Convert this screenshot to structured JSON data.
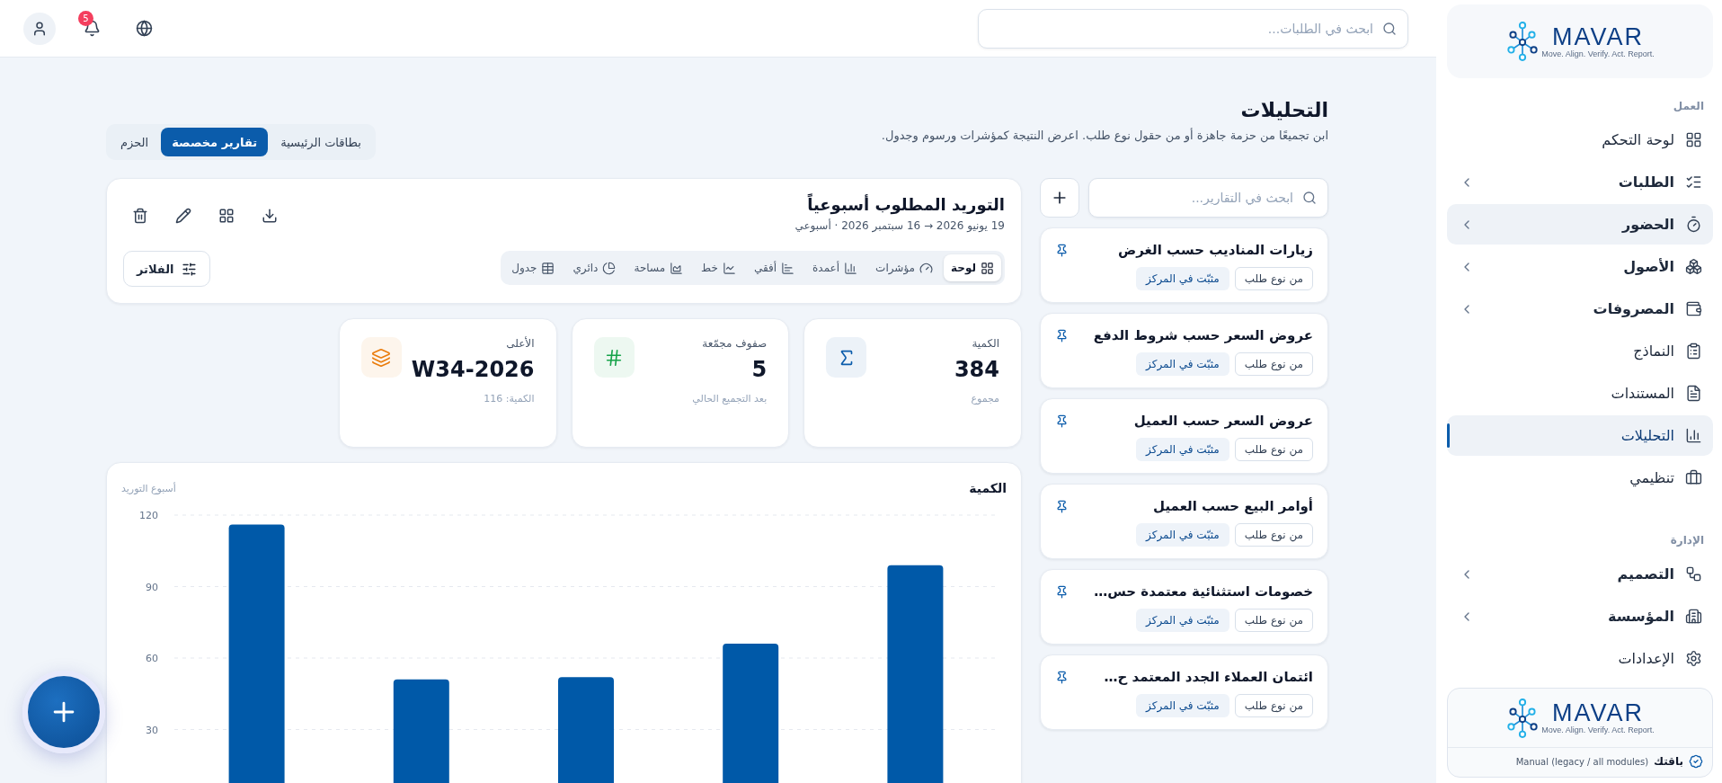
{
  "topbar": {
    "search": {
      "placeholder": "ابحث في الطلبات..."
    },
    "notifications": {
      "count": "5"
    }
  },
  "sidebar": {
    "logo": {
      "name": "MAVAR",
      "tagline": "Move. Align. Verify. Act. Report."
    },
    "sections": [
      {
        "title": "العمل",
        "items": [
          {
            "label": "لوحة التحكم",
            "has_submenu": false,
            "selected": false,
            "hovered": false
          },
          {
            "label": "الطلبات",
            "has_submenu": true,
            "selected": false,
            "hovered": false
          },
          {
            "label": "الحضور",
            "has_submenu": true,
            "selected": false,
            "hovered": true
          },
          {
            "label": "الأصول",
            "has_submenu": true,
            "selected": false,
            "hovered": false
          },
          {
            "label": "المصروفات",
            "has_submenu": true,
            "selected": false,
            "hovered": false
          },
          {
            "label": "النماذج",
            "has_submenu": false,
            "selected": false,
            "hovered": false
          },
          {
            "label": "المستندات",
            "has_submenu": false,
            "selected": false,
            "hovered": false
          },
          {
            "label": "التحليلات",
            "has_submenu": false,
            "selected": true,
            "hovered": false
          },
          {
            "label": "تنظيمي",
            "has_submenu": false,
            "selected": false,
            "hovered": false
          }
        ]
      },
      {
        "title": "الإدارة",
        "items": [
          {
            "label": "التصميم",
            "has_submenu": true,
            "selected": false,
            "hovered": false
          },
          {
            "label": "المؤسسة",
            "has_submenu": true,
            "selected": false,
            "hovered": false
          },
          {
            "label": "الإعدادات",
            "has_submenu": false,
            "selected": false,
            "hovered": false
          }
        ]
      }
    ],
    "plan": {
      "logo": {
        "name": "MAVAR",
        "tagline": "Move. Align. Verify. Act. Report."
      },
      "label": "باقتك",
      "value": "Manual (legacy / all modules)"
    }
  },
  "page": {
    "title": "التحليلات",
    "subtitle": "ابن تجميعًا من حزمة جاهزة أو من حقول نوع طلب. اعرض النتيجة كمؤشرات ورسوم وجدول.",
    "tabs": [
      {
        "label": "بطاقات الرئيسية",
        "selected": false
      },
      {
        "label": "تقارير مخصصة",
        "selected": true
      },
      {
        "label": "الحزم",
        "selected": false
      }
    ]
  },
  "reports": {
    "search": {
      "placeholder": "ابحث في التقارير..."
    },
    "items": [
      {
        "title": "زيارات المناديب حسب الغرض",
        "pinned": true,
        "tags": [
          {
            "label": "من نوع طلب",
            "kind": "outline"
          },
          {
            "label": "مثبّت في المركز",
            "kind": "filled"
          }
        ]
      },
      {
        "title": "عروض السعر حسب شروط الدفع",
        "pinned": true,
        "tags": [
          {
            "label": "من نوع طلب",
            "kind": "outline"
          },
          {
            "label": "مثبّت في المركز",
            "kind": "filled"
          }
        ]
      },
      {
        "title": "عروض السعر حسب العميل",
        "pinned": true,
        "tags": [
          {
            "label": "من نوع طلب",
            "kind": "outline"
          },
          {
            "label": "مثبّت في المركز",
            "kind": "filled"
          }
        ]
      },
      {
        "title": "أوامر البيع حسب العميل",
        "pinned": true,
        "tags": [
          {
            "label": "من نوع طلب",
            "kind": "outline"
          },
          {
            "label": "مثبّت في المركز",
            "kind": "filled"
          }
        ]
      },
      {
        "title": "خصومات استثنائية معتمدة حس…",
        "pinned": true,
        "tags": [
          {
            "label": "من نوع طلب",
            "kind": "outline"
          },
          {
            "label": "مثبّت في المركز",
            "kind": "filled"
          }
        ]
      },
      {
        "title": "ائتمان العملاء الجدد المعتمد ح…",
        "pinned": true,
        "tags": [
          {
            "label": "من نوع طلب",
            "kind": "outline"
          },
          {
            "label": "مثبّت في المركز",
            "kind": "filled"
          }
        ]
      }
    ]
  },
  "report": {
    "title": "التوريد المطلوب أسبوعياً",
    "meta": "19 يونيو 2026 → 16 سبتمبر 2026 · أسبوعي",
    "filters_label": "الفلاتر",
    "views": [
      {
        "label": "لوحة",
        "selected": true
      },
      {
        "label": "مؤشرات",
        "selected": false
      },
      {
        "label": "أعمدة",
        "selected": false
      },
      {
        "label": "أفقي",
        "selected": false
      },
      {
        "label": "خط",
        "selected": false
      },
      {
        "label": "مساحة",
        "selected": false
      },
      {
        "label": "دائري",
        "selected": false
      },
      {
        "label": "جدول",
        "selected": false
      }
    ]
  },
  "kpis": [
    {
      "label": "الكمية",
      "value": "384",
      "note": "مجموع",
      "color": "#0b5cab"
    },
    {
      "label": "صفوف مجمّعة",
      "value": "5",
      "note": "بعد التجميع الحالي",
      "color": "#16a34a"
    },
    {
      "label": "الأعلى",
      "value": "W34-2026",
      "note": "الكمية: 116",
      "color": "#ea7c0c"
    }
  ],
  "chart": {
    "chart_data": {
      "type": "bar",
      "title": "الكمية",
      "xlabel": "أسبوع التوريد",
      "ylim": [
        0,
        120
      ],
      "yticks": [
        30,
        60,
        90,
        120
      ],
      "grid": true,
      "values": [
        116,
        51,
        52,
        66,
        99
      ]
    }
  }
}
